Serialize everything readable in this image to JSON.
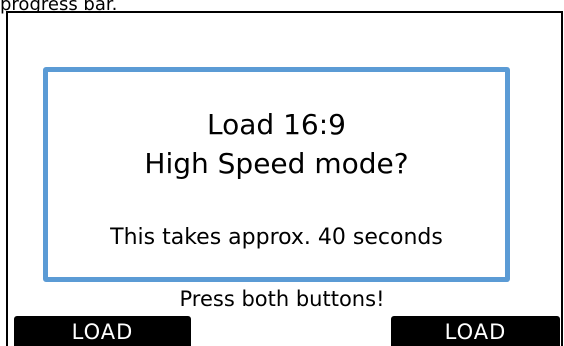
{
  "caption": "progress bar.",
  "dialog": {
    "title_line1": "Load 16:9",
    "title_line2": "High Speed mode?",
    "note": "This takes approx. 40 seconds"
  },
  "instruction": "Press both buttons!",
  "buttons": {
    "left_label": "LOAD",
    "right_label": "LOAD"
  },
  "colors": {
    "dialog_border": "#5b9bd5",
    "button_background": "#000000",
    "button_text": "#ffffff"
  }
}
